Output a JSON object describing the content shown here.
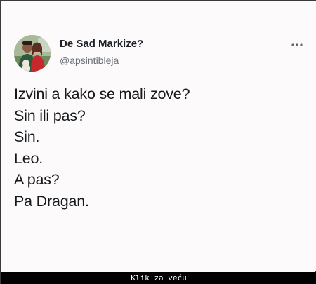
{
  "tweet": {
    "author": {
      "display_name": "De Sad Markize?",
      "handle": "@apsintibleja",
      "avatar_icon": "profile-photo"
    },
    "menu_icon": "more-horizontal-icon",
    "text_lines": [
      "Izvini a kako se mali zove?",
      "Sin ili pas?",
      "Sin.",
      "Leo.",
      "A pas?",
      "Pa Dragan."
    ]
  },
  "footer": {
    "link_label": "Klik za veću"
  },
  "colors": {
    "card_background": "#fdfafb",
    "text_primary": "#15181c",
    "text_secondary": "#6b7279",
    "footer_background": "#000000",
    "footer_text": "#ffffff"
  }
}
